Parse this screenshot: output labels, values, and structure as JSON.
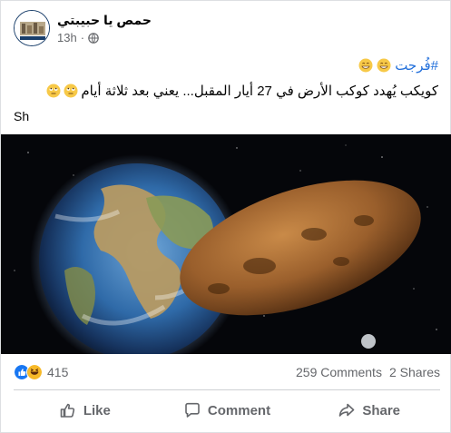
{
  "post": {
    "author": "حمص يا حبيبتي",
    "time": "13h",
    "separator": "·",
    "hashtag": "#فُرجت",
    "text": "كويكب يُهدد كوكب الأرض في 27 أيار المقبل... يعني بعد ثلاثة أيام",
    "extra": "Sh",
    "icons": {
      "privacy": "globe-icon",
      "hashtag_emoji": "grinning-face-icon",
      "text_emoji": "rolling-eyes-face-icon"
    }
  },
  "stats": {
    "reactions_count": "415",
    "comments": "259 Comments",
    "shares": "2 Shares",
    "reaction_types": [
      "like-reaction-icon",
      "haha-reaction-icon"
    ]
  },
  "actions": {
    "like": "Like",
    "comment": "Comment",
    "share": "Share"
  },
  "colors": {
    "link": "#216fdb",
    "muted": "#65676b",
    "like_blue": "#1877f2",
    "haha_yellow": "#f7b928"
  }
}
